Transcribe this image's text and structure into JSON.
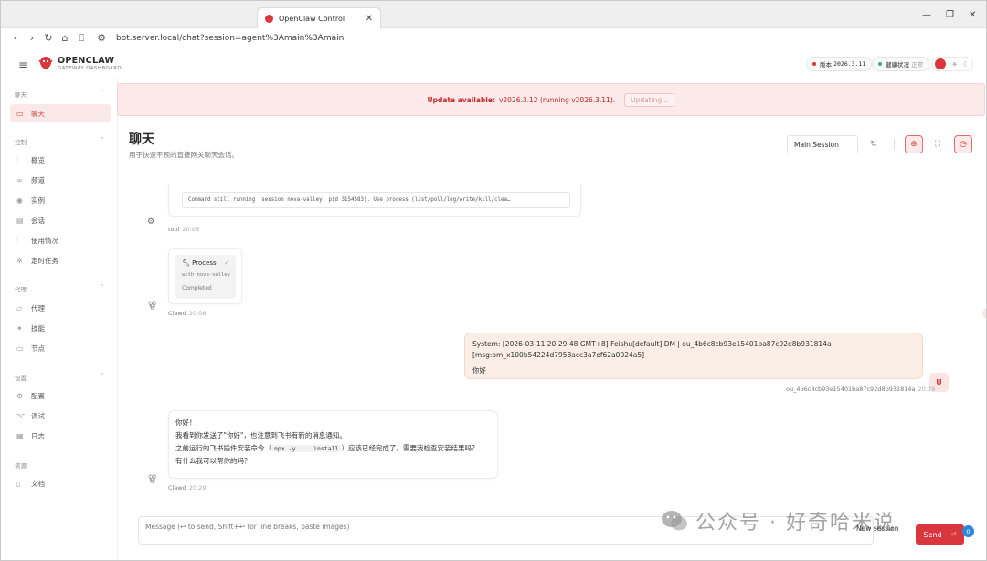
{
  "browser": {
    "tab_title": "OpenClaw Control",
    "url": "bot.server.local/chat?session=agent%3Amain%3Amain",
    "win_min": "—",
    "win_restore": "❐",
    "win_close": "✕"
  },
  "header": {
    "brand": "OPENCLAW",
    "brand_sub": "GATEWAY DASHBOARD",
    "version_label": "版本",
    "version_value": "2026.3.11",
    "health_label": "健康状况",
    "health_value": "正常"
  },
  "colors": {
    "accent": "#d9363e",
    "health_ok": "#36b37e",
    "banner_bg": "#fce9e9",
    "user_bubble": "#faeee6"
  },
  "sidebar": {
    "sections": [
      {
        "label": "聊天",
        "items": [
          {
            "label": "聊天",
            "icon": "chat-bubble-icon",
            "active": true
          }
        ]
      },
      {
        "label": "控制",
        "items": [
          {
            "label": "概览",
            "icon": "bar-chart-icon"
          },
          {
            "label": "频道",
            "icon": "link-icon"
          },
          {
            "label": "实例",
            "icon": "broadcast-icon"
          },
          {
            "label": "会话",
            "icon": "document-icon"
          },
          {
            "label": "使用情况",
            "icon": "usage-chart-icon"
          },
          {
            "label": "定时任务",
            "icon": "spinner-icon"
          }
        ]
      },
      {
        "label": "代理",
        "items": [
          {
            "label": "代理",
            "icon": "folder-icon"
          },
          {
            "label": "技能",
            "icon": "sparkle-icon"
          },
          {
            "label": "节点",
            "icon": "monitor-icon"
          }
        ]
      },
      {
        "label": "设置",
        "items": [
          {
            "label": "配置",
            "icon": "gear-icon"
          },
          {
            "label": "调试",
            "icon": "bug-icon"
          },
          {
            "label": "日志",
            "icon": "log-icon"
          }
        ]
      },
      {
        "label": "资源",
        "items": [
          {
            "label": "文档",
            "icon": "book-icon"
          }
        ]
      }
    ]
  },
  "banner": {
    "title": "Update available:",
    "detail": "v2026.3.12 (running v2026.3.11).",
    "button": "Updating..."
  },
  "page": {
    "title": "聊天",
    "subtitle": "用于快速干预的直接网关聊天会话。",
    "session": "Main Session"
  },
  "messages": {
    "tool_output": "Command still running (session nova-valley, pid 3154583). Use process (list/poll/log/write/kill/clea…",
    "tool_author": "tool",
    "tool_time": "20:06",
    "process_title": "Process",
    "process_with": "with nova-valley",
    "process_status": "Completed",
    "proc_author": "Clawd",
    "proc_time": "20:08",
    "user_line1": "System: [2026-03-11 20:29:48 GMT+8] Feishu[default] DM | ou_4b6c8cb93e15401ba87c92d8b931814a",
    "user_line2": "[msg:om_x100b54224d7958acc3a7ef62a0024a5]",
    "user_line3": "你好",
    "user_author": "ou_4b6c8cb93e15401ba87c92d8b931814a",
    "user_time": "20:29",
    "user_avatar": "U",
    "bot_line1": "你好！",
    "bot_line2": "我看到你发送了\"你好\"，也注意到飞书有新的消息通知。",
    "bot_line3a": "之前运行的飞书插件安装命令（",
    "bot_code": "npx -y ... install",
    "bot_line3b": "）应该已经完成了。需要我检查安装结果吗？",
    "bot_line4": "有什么我可以帮你的吗？",
    "bot_author": "Clawd",
    "bot_time": "20:29"
  },
  "composer": {
    "placeholder": "Message (↩ to send, Shift+↩ for line breaks, paste images)",
    "new_session": "New session",
    "send": "Send",
    "badge": "0"
  },
  "watermark": "公众号 · 好奇哈米说"
}
